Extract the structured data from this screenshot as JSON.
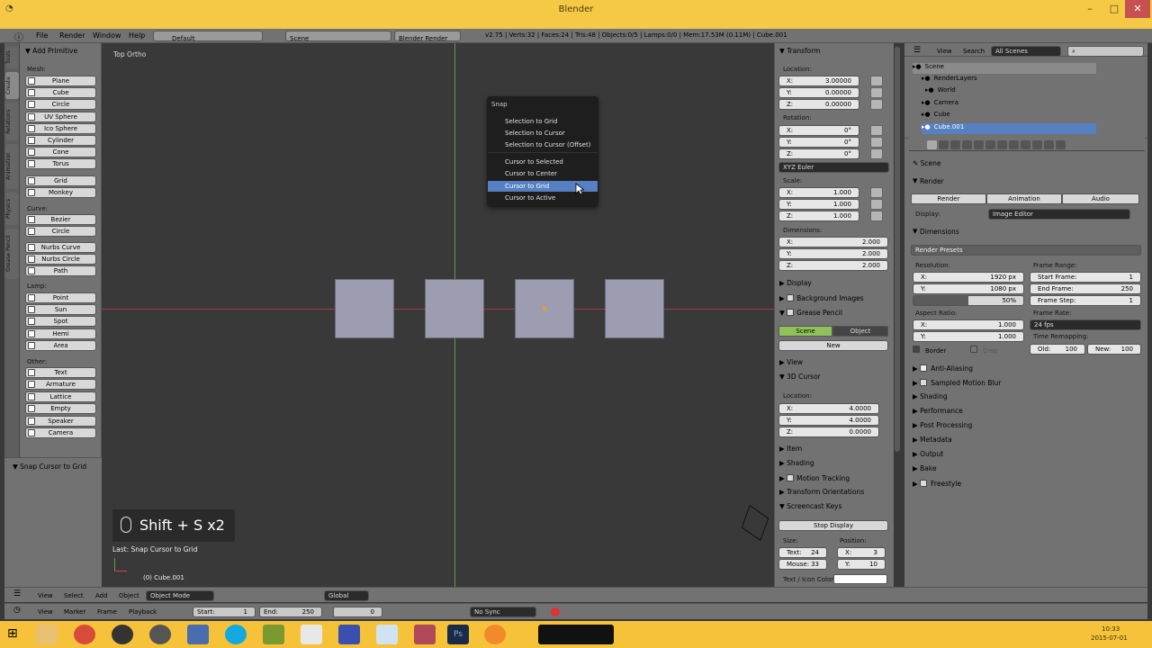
{
  "app": {
    "title": "Blender"
  },
  "info": {
    "menus": [
      "File",
      "Render",
      "Window",
      "Help"
    ],
    "layout": "Default",
    "scene": "Scene",
    "engine": "Blender Render",
    "stats": "v2.75 | Verts:32 | Faces:24 | Tris:48 | Objects:0/5 | Lamps:0/0 | Mem:17.53M (0.11M) | Cube.001"
  },
  "toolshelf": {
    "tabs": [
      "Tools",
      "Create",
      "Relations",
      "Animation",
      "Physics",
      "Grease Pencil"
    ],
    "header": "Add Primitive",
    "mesh_label": "Mesh:",
    "mesh": [
      "Plane",
      "Cube",
      "Circle",
      "UV Sphere",
      "Ico Sphere",
      "Cylinder",
      "Cone",
      "Torus"
    ],
    "mesh2": [
      "Grid",
      "Monkey"
    ],
    "curve_label": "Curve:",
    "curve": [
      "Bezier",
      "Circle"
    ],
    "curve2": [
      "Nurbs Curve",
      "Nurbs Circle",
      "Path"
    ],
    "lamp_label": "Lamp:",
    "lamp": [
      "Point",
      "Sun",
      "Spot",
      "Hemi",
      "Area"
    ],
    "other_label": "Other:",
    "other": [
      "Text",
      "Armature",
      "Lattice",
      "Empty",
      "Speaker",
      "Camera"
    ],
    "operator": "Snap Cursor to Grid"
  },
  "viewport": {
    "view_name": "Top Ortho",
    "shortcut": "Shift + S x2",
    "last_op": "Last: Snap Cursor to Grid",
    "object_info": "(0) Cube.001"
  },
  "snap_menu": {
    "title": "Snap",
    "items": [
      "Selection to Grid",
      "Selection to Cursor",
      "Selection to Cursor (Offset)",
      "Cursor to Selected",
      "Cursor to Center",
      "Cursor to Grid",
      "Cursor to Active"
    ],
    "selected": "Cursor to Grid"
  },
  "transform": {
    "header": "Transform",
    "location_label": "Location:",
    "location": [
      {
        "axis": "X:",
        "value": "3.00000"
      },
      {
        "axis": "Y:",
        "value": "0.00000"
      },
      {
        "axis": "Z:",
        "value": "0.00000"
      }
    ],
    "rotation_label": "Rotation:",
    "rotation": [
      {
        "axis": "X:",
        "value": "0°"
      },
      {
        "axis": "Y:",
        "value": "0°"
      },
      {
        "axis": "Z:",
        "value": "0°"
      }
    ],
    "rotation_mode": "XYZ Euler",
    "scale_label": "Scale:",
    "scale": [
      {
        "axis": "X:",
        "value": "1.000"
      },
      {
        "axis": "Y:",
        "value": "1.000"
      },
      {
        "axis": "Z:",
        "value": "1.000"
      }
    ],
    "dimensions_label": "Dimensions:",
    "dimensions": [
      {
        "axis": "X:",
        "value": "2.000"
      },
      {
        "axis": "Y:",
        "value": "2.000"
      },
      {
        "axis": "Z:",
        "value": "2.000"
      }
    ]
  },
  "nprops": {
    "display": "Display",
    "background_images": "Background Images",
    "grease_pencil": "Grease Pencil",
    "gp_scene": "Scene",
    "gp_object": "Object",
    "gp_new": "New",
    "view": "View",
    "cursor3d": "3D Cursor",
    "cursor_location_label": "Location:",
    "cursor_location": [
      {
        "axis": "X:",
        "value": "4.0000"
      },
      {
        "axis": "Y:",
        "value": "4.0000"
      },
      {
        "axis": "Z:",
        "value": "0.0000"
      }
    ],
    "item": "Item",
    "shading": "Shading",
    "motion_tracking": "Motion Tracking",
    "transform_orientations": "Transform Orientations",
    "screencast": "Screencast Keys",
    "stop_display": "Stop Display",
    "size_label": "Size:",
    "position_label": "Position:",
    "size_text": "Text:",
    "size_text_v": "24",
    "size_mouse": "Mouse:",
    "size_mouse_v": "33",
    "pos_x": "X:",
    "pos_x_v": "3",
    "pos_y": "Y:",
    "pos_y_v": "10",
    "text_icon_color": "Text / Icon Color:"
  },
  "outliner": {
    "menus": [
      "View",
      "Search"
    ],
    "filter": "All Scenes",
    "items": [
      "Scene",
      "RenderLayers",
      "World",
      "Camera",
      "Cube",
      "Cube.001"
    ]
  },
  "properties": {
    "breadcrumb": "Scene",
    "render_header": "Render",
    "render_btn": "Render",
    "animation_btn": "Animation",
    "audio_btn": "Audio",
    "display_label": "Display:",
    "display_value": "Image Editor",
    "dimensions_header": "Dimensions",
    "render_presets": "Render Presets",
    "resolution_label": "Resolution:",
    "res_x": "X:",
    "res_x_v": "1920 px",
    "res_y": "Y:",
    "res_y_v": "1080 px",
    "res_pct": "50%",
    "frame_range_label": "Frame Range:",
    "start_frame": "Start Frame:",
    "start_frame_v": "1",
    "end_frame": "End Frame:",
    "end_frame_v": "250",
    "frame_step": "Frame Step:",
    "frame_step_v": "1",
    "aspect_label": "Aspect Ratio:",
    "asp_x": "X:",
    "asp_x_v": "1.000",
    "asp_y": "Y:",
    "asp_y_v": "1.000",
    "frame_rate_label": "Frame Rate:",
    "frame_rate": "24 fps",
    "time_remap": "Time Remapping:",
    "old": "Old:",
    "old_v": "100",
    "new": "New:",
    "new_v": "100",
    "border": "Border",
    "crop": "Crop",
    "panels": [
      "Anti-Aliasing",
      "Sampled Motion Blur",
      "Shading",
      "Performance",
      "Post Processing",
      "Metadata",
      "Output",
      "Bake",
      "Freestyle"
    ]
  },
  "viewport_header": {
    "menus": [
      "View",
      "Select",
      "Add",
      "Object"
    ],
    "mode": "Object Mode",
    "orientation": "Global"
  },
  "timeline": {
    "menus": [
      "View",
      "Marker",
      "Frame",
      "Playback"
    ],
    "start_label": "Start:",
    "start": "1",
    "end_label": "End:",
    "end": "250",
    "current": "0",
    "sync": "No Sync"
  },
  "taskbar": {
    "time": "10:33",
    "date": "2015-07-01"
  }
}
